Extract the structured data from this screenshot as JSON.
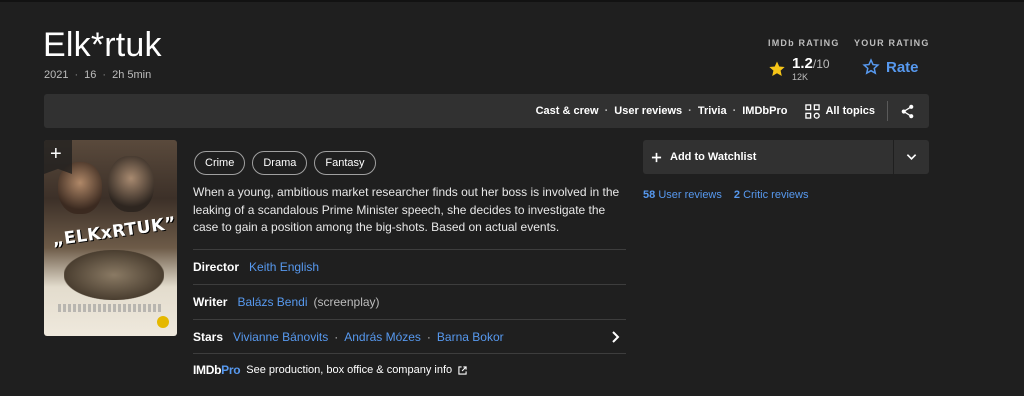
{
  "title": "Elk*rtuk",
  "meta": {
    "year": "2021",
    "certificate": "16",
    "runtime": "2h 5min"
  },
  "rating": {
    "label": "IMDb RATING",
    "value": "1.2",
    "out_of": "/10",
    "count": "12K",
    "your_label": "YOUR RATING",
    "rate_label": "Rate",
    "star_color": "#f5c518",
    "accent_color": "#5799ef"
  },
  "subnav": {
    "links": [
      "Cast & crew",
      "User reviews",
      "Trivia",
      "IMDbPro"
    ],
    "all_topics": "All topics",
    "share_icon": "share-icon"
  },
  "poster": {
    "title_text": "„ELKхRTUK”",
    "add_icon": "+"
  },
  "genres": [
    "Crime",
    "Drama",
    "Fantasy"
  ],
  "plot": "When a young, ambitious market researcher finds out her boss is involved in the leaking of a scandalous Prime Minister speech, she decides to investigate the case to gain a position among the big-shots. Based on actual events.",
  "credits": {
    "director": {
      "role": "Director",
      "names": [
        "Keith English"
      ]
    },
    "writer": {
      "role": "Writer",
      "names": [
        "Balázs Bendi"
      ],
      "note": "(screenplay)"
    },
    "stars": {
      "role": "Stars",
      "names": [
        "Vivianne Bánovits",
        "András Mózes",
        "Barna Bokor"
      ]
    }
  },
  "imdbpro": {
    "logo_main": "IMDb",
    "logo_pro": "Pro",
    "text": "See production, box office & company info"
  },
  "watchlist": {
    "label": "Add to Watchlist"
  },
  "reviews": {
    "user_count": "58",
    "user_label": "User reviews",
    "critic_count": "2",
    "critic_label": "Critic reviews"
  }
}
